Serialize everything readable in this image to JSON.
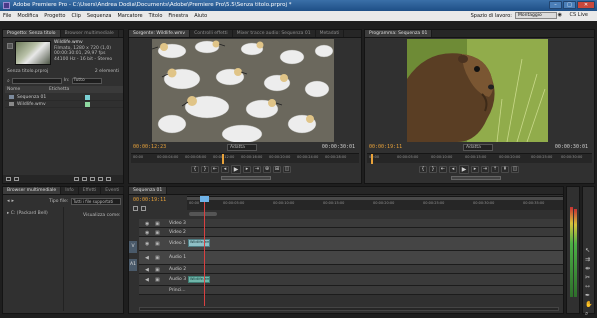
{
  "window": {
    "title": "Adobe Premiere Pro - C:\\Users\\Andrea Dodia\\Documents\\Adobe\\Premiere Pro\\5.5\\Senza titolo.prproj *",
    "minimize": "–",
    "maximize": "□",
    "close": "✕"
  },
  "menu": [
    "File",
    "Modifica",
    "Progetto",
    "Clip",
    "Sequenza",
    "Marcatore",
    "Titolo",
    "Finestra",
    "Aiuto"
  ],
  "workspace": {
    "label": "Spazio di lavoro:",
    "value": "Montaggio",
    "cs_live": "CS Live"
  },
  "project": {
    "tabs": [
      "Progetto: Senza titolo",
      "Browser multimediale"
    ],
    "clip_name": "Wildlife.wmv",
    "clip_info": [
      "Filmato, 1280 x 720 (1,0)",
      "00:00:30:01, 29,97 fps",
      "44100 Hz - 16 bit - Stereo"
    ],
    "project_name": "Senza titolo.prproj",
    "elements": "2 elementi",
    "search_label": "In:",
    "search_value": "Tutto",
    "columns": [
      "Nome",
      "Etichetta"
    ],
    "items": [
      {
        "name": "Sequenza 01",
        "color": "#7bd1d5"
      },
      {
        "name": "Wildlife.wmv",
        "color": "#8fd9a0"
      }
    ]
  },
  "source": {
    "tabs": [
      "Sorgente: Wildlife.wmv",
      "Controlli effetti",
      "Mixer tracce audio: Sequenza 01",
      "Metadati"
    ],
    "timecode": "00:00:12:23",
    "zoom": "Adatta",
    "duration": "00:00:30:01",
    "ruler": [
      "00:00",
      "00:00:04:00",
      "00:00:08:00",
      "00:00:12:00",
      "00:00:16:00",
      "00:00:20:00",
      "00:00:24:00",
      "00:00:28:00"
    ]
  },
  "program": {
    "tabs": [
      "Programma: Sequenza 01"
    ],
    "timecode": "00:00:19:11",
    "zoom": "Adatta",
    "duration": "00:00:30:01",
    "ruler": [
      "00:00",
      "00:00:05:00",
      "00:00:10:00",
      "00:00:15:00",
      "00:00:20:00",
      "00:00:25:00",
      "00:00:30:00"
    ]
  },
  "media": {
    "tabs": [
      "Browser multimediale",
      "Info",
      "Effetti",
      "Eventi",
      "Storia"
    ],
    "file_types_label": "Tipo file:",
    "file_types_value": "Tutti i file supportati",
    "view_label": "Visualizza come:",
    "drive": "C: (Packard Bell)"
  },
  "timeline": {
    "tab": "Sequenza 01",
    "timecode": "00:00:19:11",
    "ruler": [
      "00:00",
      "00:00:05:00",
      "00:00:10:00",
      "00:00:15:00",
      "00:00:20:00",
      "00:00:25:00",
      "00:00:30:00",
      "00:00:35:00"
    ],
    "tracks": [
      {
        "name": "Video 3",
        "kind": "video",
        "clip": ""
      },
      {
        "name": "Video 2",
        "kind": "video",
        "clip": ""
      },
      {
        "name": "Video 1",
        "kind": "video",
        "clip": "Wildlife.wmv"
      },
      {
        "name": "Audio 1",
        "kind": "audio",
        "clip": ""
      },
      {
        "name": "Audio 2",
        "kind": "audio",
        "clip": ""
      },
      {
        "name": "Audio 3",
        "kind": "audio",
        "clip": "Wildlife.wmv"
      },
      {
        "name": "Princi...",
        "kind": "master",
        "clip": ""
      }
    ],
    "tab_v": "V",
    "tab_a": "A1"
  },
  "colors": {
    "timecode": "#e8a23a",
    "playhead": "#d84141",
    "titlebar": "#2b5e96"
  }
}
